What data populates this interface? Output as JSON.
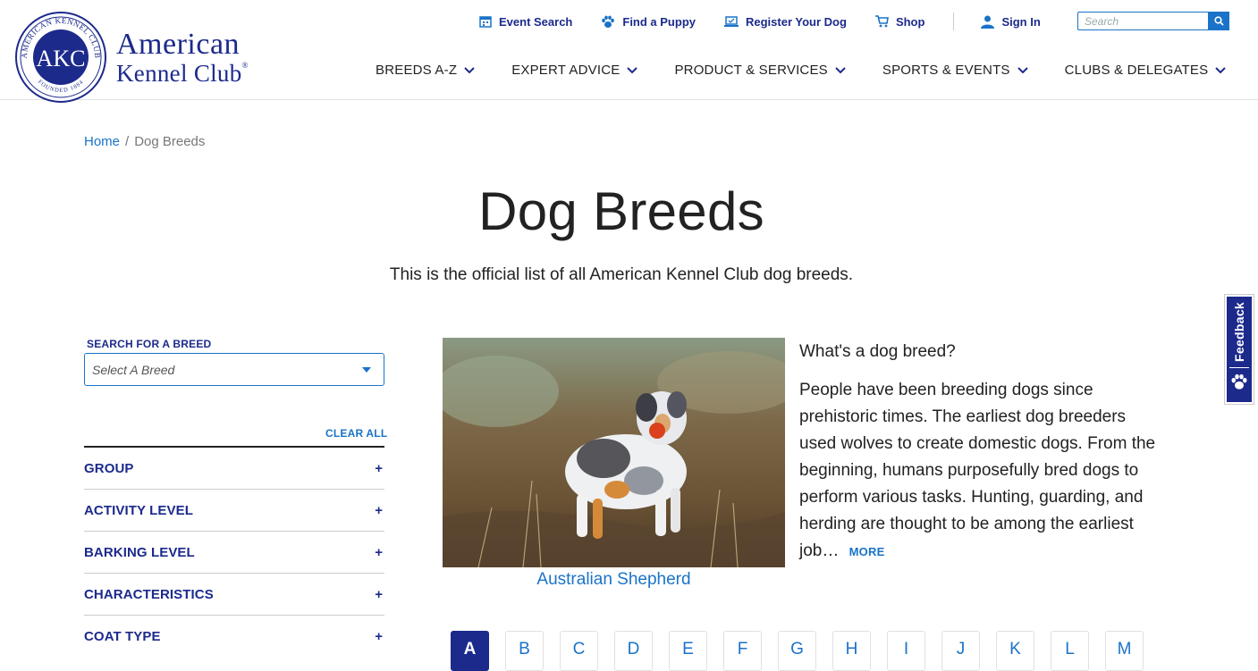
{
  "brand": {
    "seal_ring_text": "AMERICAN KENNEL CLUB",
    "seal_monogram": "AKC",
    "seal_founded": "FOUNDED 1884",
    "wordmark_line1": "American",
    "wordmark_line2": "Kennel Club",
    "wordmark_mark": "®"
  },
  "utility_nav": {
    "items": [
      {
        "label": "Event Search",
        "icon": "calendar-icon"
      },
      {
        "label": "Find a Puppy",
        "icon": "paw-icon"
      },
      {
        "label": "Register Your Dog",
        "icon": "laptop-icon"
      },
      {
        "label": "Shop",
        "icon": "cart-icon"
      }
    ],
    "sign_in": {
      "label": "Sign In",
      "icon": "user-icon"
    }
  },
  "search": {
    "placeholder": "Search",
    "icon": "search-icon"
  },
  "main_nav": {
    "items": [
      "BREEDS A-Z",
      "EXPERT ADVICE",
      "PRODUCT & SERVICES",
      "SPORTS & EVENTS",
      "CLUBS & DELEGATES"
    ]
  },
  "breadcrumb": {
    "home": "Home",
    "separator": "/",
    "current": "Dog Breeds"
  },
  "page": {
    "title": "Dog Breeds",
    "subtitle": "This is the official list of all American Kennel Club dog breeds."
  },
  "filters": {
    "search_label": "SEARCH FOR A BREED",
    "select_placeholder": "Select A Breed",
    "clear_all": "CLEAR ALL",
    "groups": [
      "GROUP",
      "ACTIVITY LEVEL",
      "BARKING LEVEL",
      "CHARACTERISTICS",
      "COAT TYPE"
    ],
    "expand_symbol": "+"
  },
  "featured": {
    "breed_name": "Australian Shepherd"
  },
  "info": {
    "title": "What's a dog breed?",
    "body": "People have been breeding dogs since prehistoric times. The earliest dog breeders used wolves to create domestic dogs. From the beginning, humans purposefully bred dogs to perform various tasks. Hunting, guarding, and herding are thought to be among the earliest job…",
    "more": "MORE"
  },
  "alphabet": {
    "letters": [
      "A",
      "B",
      "C",
      "D",
      "E",
      "F",
      "G",
      "H",
      "I",
      "J",
      "K",
      "L",
      "M"
    ],
    "active": "A"
  },
  "feedback": {
    "label": "Feedback"
  },
  "colors": {
    "navy": "#1c2a8c",
    "link_blue": "#1a73c8"
  }
}
